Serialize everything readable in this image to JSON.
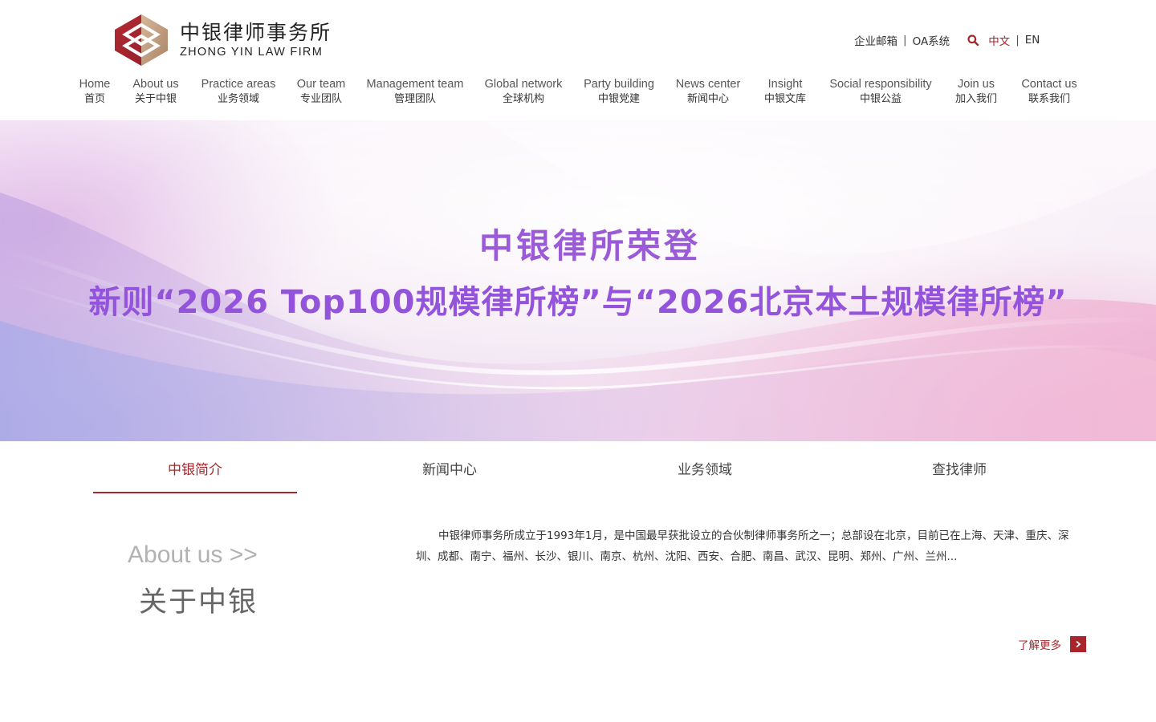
{
  "header": {
    "logo": {
      "name_cn": "中银律师事务所",
      "name_en": "ZHONG YIN LAW FIRM"
    },
    "top_links": {
      "mail": "企业邮箱",
      "oa": "OA系统",
      "lang_cn": "中文",
      "lang_en": "EN",
      "separator": "|"
    }
  },
  "nav": [
    {
      "en": "Home",
      "cn": "首页"
    },
    {
      "en": "About us",
      "cn": "关于中银"
    },
    {
      "en": "Practice areas",
      "cn": "业务领域"
    },
    {
      "en": "Our team",
      "cn": "专业团队"
    },
    {
      "en": "Management team",
      "cn": "管理团队"
    },
    {
      "en": "Global network",
      "cn": "全球机构"
    },
    {
      "en": "Party building",
      "cn": "中银党建"
    },
    {
      "en": "News center",
      "cn": "新闻中心"
    },
    {
      "en": "Insight",
      "cn": "中银文库"
    },
    {
      "en": "Social responsibility",
      "cn": "中银公益"
    },
    {
      "en": "Join us",
      "cn": "加入我们"
    },
    {
      "en": "Contact us",
      "cn": "联系我们"
    }
  ],
  "banner": {
    "line1": "中银律所荣登",
    "line2": "新则“2026 Top100规模律所榜”与“2026北京本土规模律所榜”"
  },
  "tabs": [
    {
      "label": "中银简介",
      "active": true
    },
    {
      "label": "新闻中心",
      "active": false
    },
    {
      "label": "业务领域",
      "active": false
    },
    {
      "label": "查找律师",
      "active": false
    }
  ],
  "about": {
    "title_en": "About us >>",
    "title_cn": "关于中银",
    "text": "中银律师事务所成立于1993年1月，是中国最早获批设立的合伙制律师事务所之一；总部设在北京，目前已在上海、天津、重庆、深圳、成都、南宁、福州、长沙、银川、南京、杭州、沈阳、西安、合肥、南昌、武汉、昆明、郑州、广州、兰州...",
    "more_label": "了解更多"
  },
  "colors": {
    "brand": "#a8262b",
    "banner_text": "#9354db"
  }
}
